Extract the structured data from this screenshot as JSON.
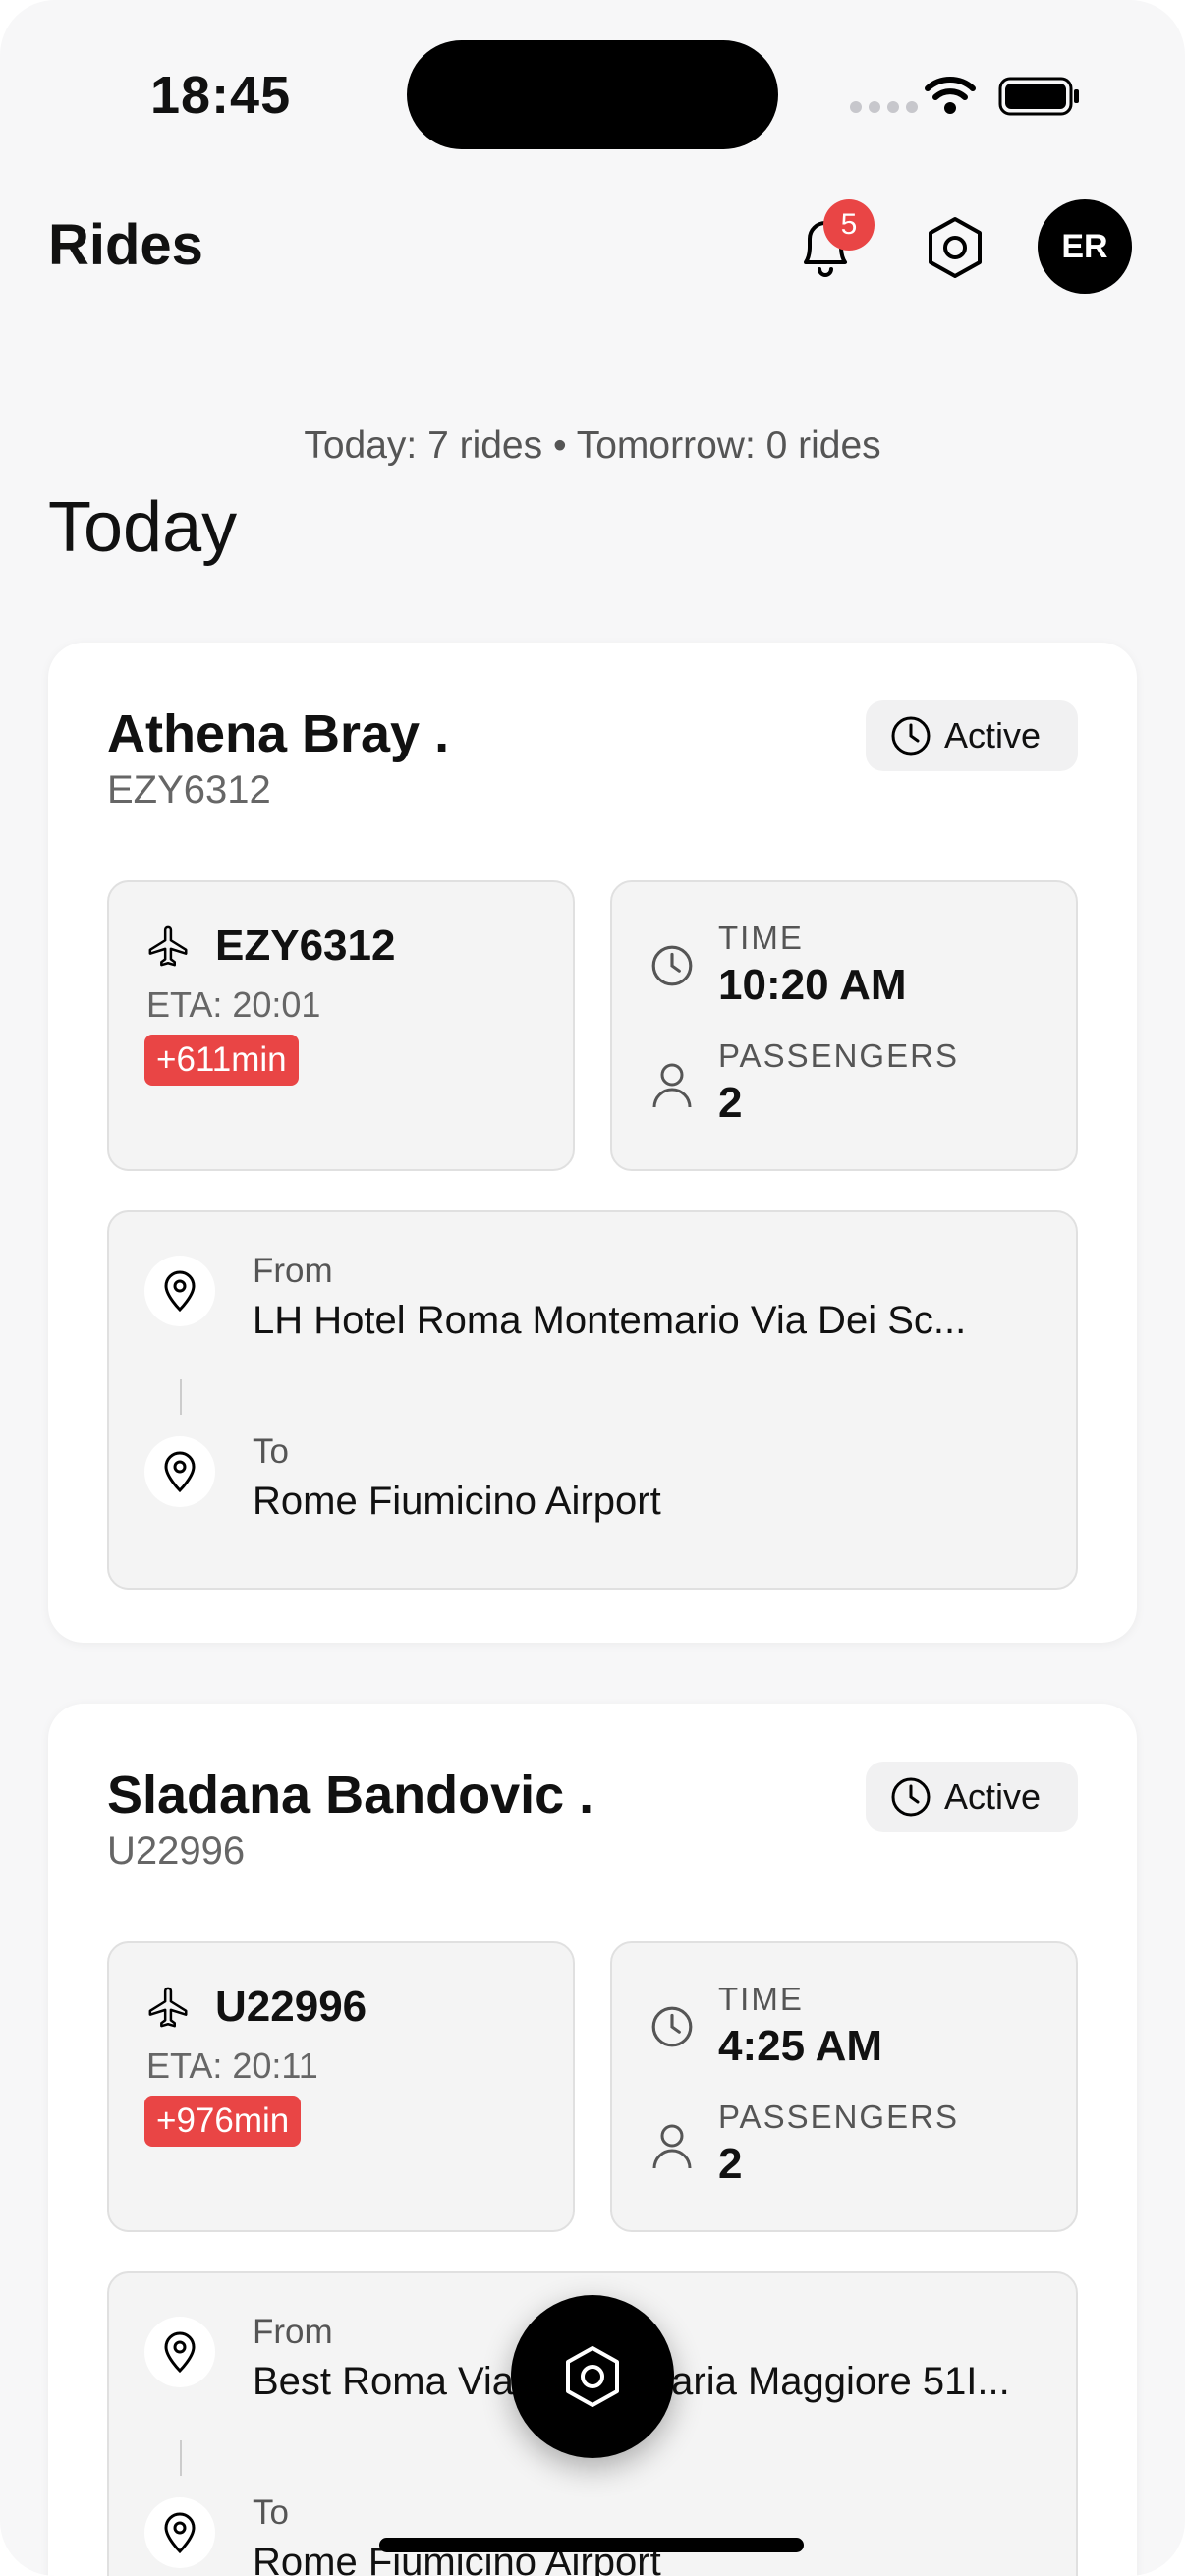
{
  "status_bar": {
    "time": "18:45"
  },
  "header": {
    "title": "Rides",
    "notification_count": "5",
    "avatar_initials": "ER"
  },
  "summary": "Today: 7 rides • Tomorrow: 0 rides",
  "section_title": "Today",
  "labels": {
    "time": "TIME",
    "passengers": "PASSENGERS",
    "from": "From",
    "to": "To"
  },
  "rides": [
    {
      "name": "Athena Bray .",
      "code": "EZY6312",
      "status": "Active",
      "flight": "EZY6312",
      "eta": "ETA: 20:01",
      "delay": "+611min",
      "time": "10:20 AM",
      "passengers": "2",
      "from": "LH Hotel Roma Montemario Via Dei Sc...",
      "to": "Rome Fiumicino Airport"
    },
    {
      "name": "Sladana Bandovic .",
      "code": "U22996",
      "status": "Active",
      "flight": "U22996",
      "eta": "ETA: 20:11",
      "delay": "+976min",
      "time": "4:25 AM",
      "passengers": "2",
      "from": "Best Roma Via Santa Maria Maggiore 51I...",
      "to": "Rome Fiumicino Airport"
    }
  ],
  "icons": {
    "bell": "bell-icon",
    "settings": "hexagon-settings-icon",
    "clock": "clock-icon",
    "plane": "plane-icon",
    "person": "person-icon",
    "pin": "map-pin-icon"
  },
  "colors": {
    "accent": "#000000",
    "alert": "#e94545",
    "background": "#f7f7f8"
  }
}
